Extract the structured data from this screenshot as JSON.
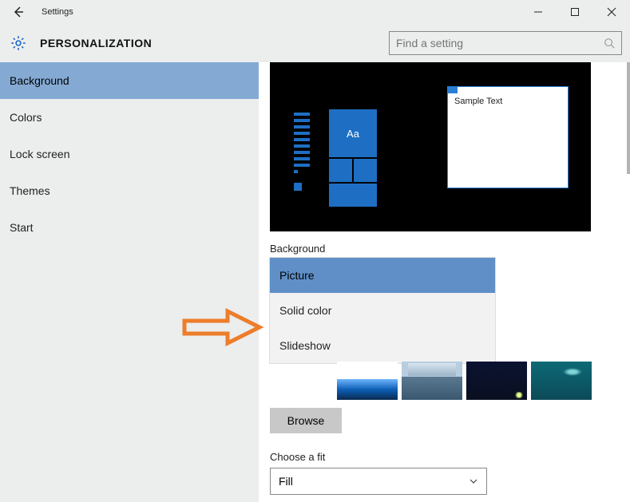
{
  "window": {
    "title": "Settings"
  },
  "header": {
    "page": "PERSONALIZATION",
    "search_placeholder": "Find a setting"
  },
  "sidebar": {
    "items": [
      {
        "label": "Background",
        "active": true
      },
      {
        "label": "Colors",
        "active": false
      },
      {
        "label": "Lock screen",
        "active": false
      },
      {
        "label": "Themes",
        "active": false
      },
      {
        "label": "Start",
        "active": false
      }
    ]
  },
  "preview": {
    "sample_text": "Sample Text",
    "tile_letter": "Aa"
  },
  "background": {
    "section_label": "Background",
    "options": [
      "Picture",
      "Solid color",
      "Slideshow"
    ],
    "selected": "Picture",
    "browse_label": "Browse"
  },
  "fit": {
    "section_label": "Choose a fit",
    "value": "Fill"
  }
}
